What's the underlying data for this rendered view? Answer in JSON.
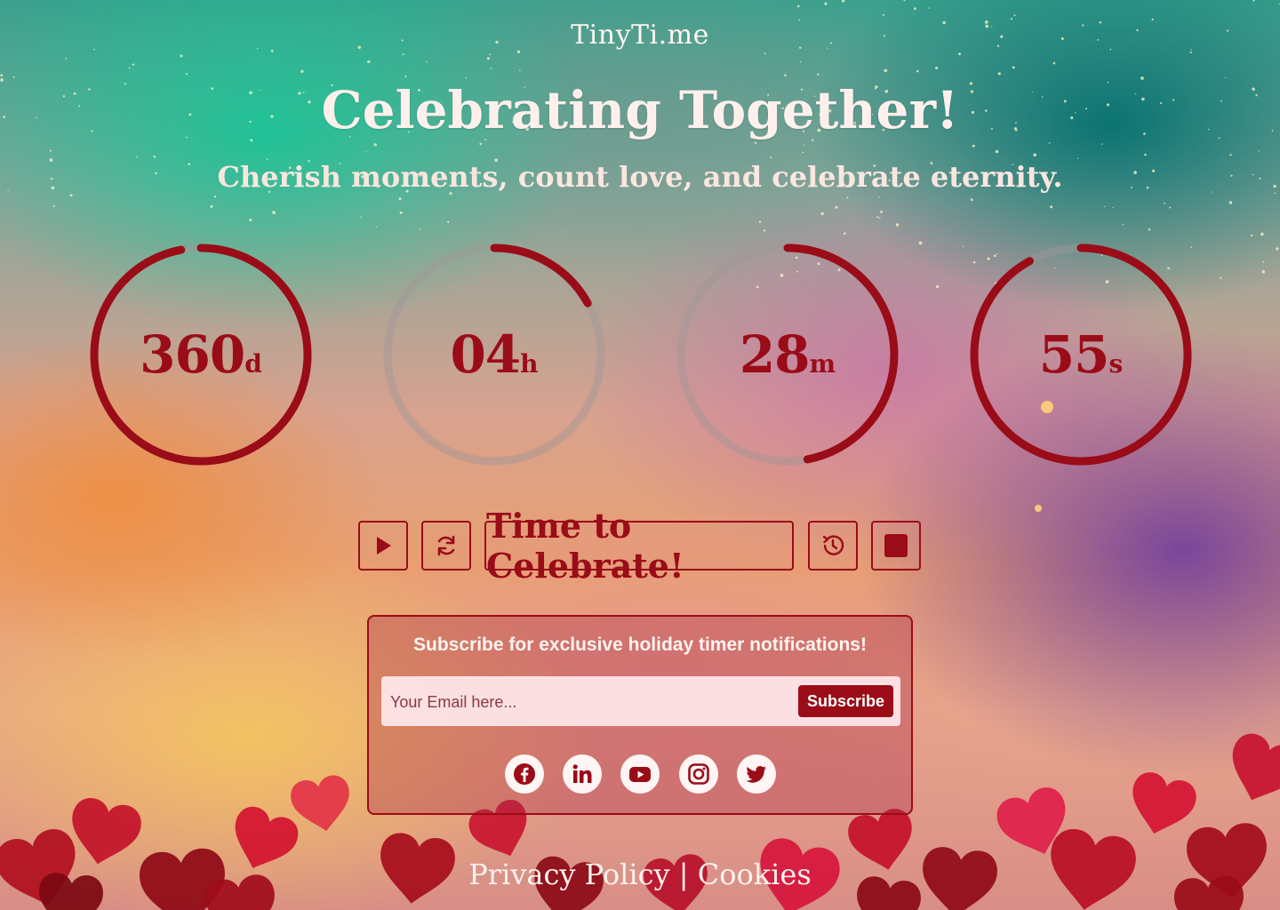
{
  "brand": "TinyTi.me",
  "headline": "Celebrating Together!",
  "subheadline": "Cherish moments, count love, and celebrate eternity.",
  "colors": {
    "accent": "#9a0c18",
    "text_light": "#fff0ec"
  },
  "timers": [
    {
      "value": "360",
      "unit": "d",
      "progress": 0.97
    },
    {
      "value": "04",
      "unit": "h",
      "progress": 0.17
    },
    {
      "value": "28",
      "unit": "m",
      "progress": 0.47
    },
    {
      "value": "55",
      "unit": "s",
      "progress": 0.92
    }
  ],
  "controls": {
    "play_icon": "play-icon",
    "reset_icon": "refresh-icon",
    "celebrate_label": "Time to Celebrate!",
    "history_icon": "history-icon",
    "stop_icon": "stop-icon"
  },
  "subscribe": {
    "title": "Subscribe for exclusive holiday timer notifications!",
    "placeholder": "Your Email here...",
    "button_label": "Subscribe"
  },
  "socials": [
    {
      "icon": "facebook-icon"
    },
    {
      "icon": "linkedin-icon"
    },
    {
      "icon": "youtube-icon"
    },
    {
      "icon": "instagram-icon"
    },
    {
      "icon": "twitter-icon"
    }
  ],
  "footer": {
    "privacy": "Privacy Policy",
    "separator": "|",
    "cookies": "Cookies"
  }
}
